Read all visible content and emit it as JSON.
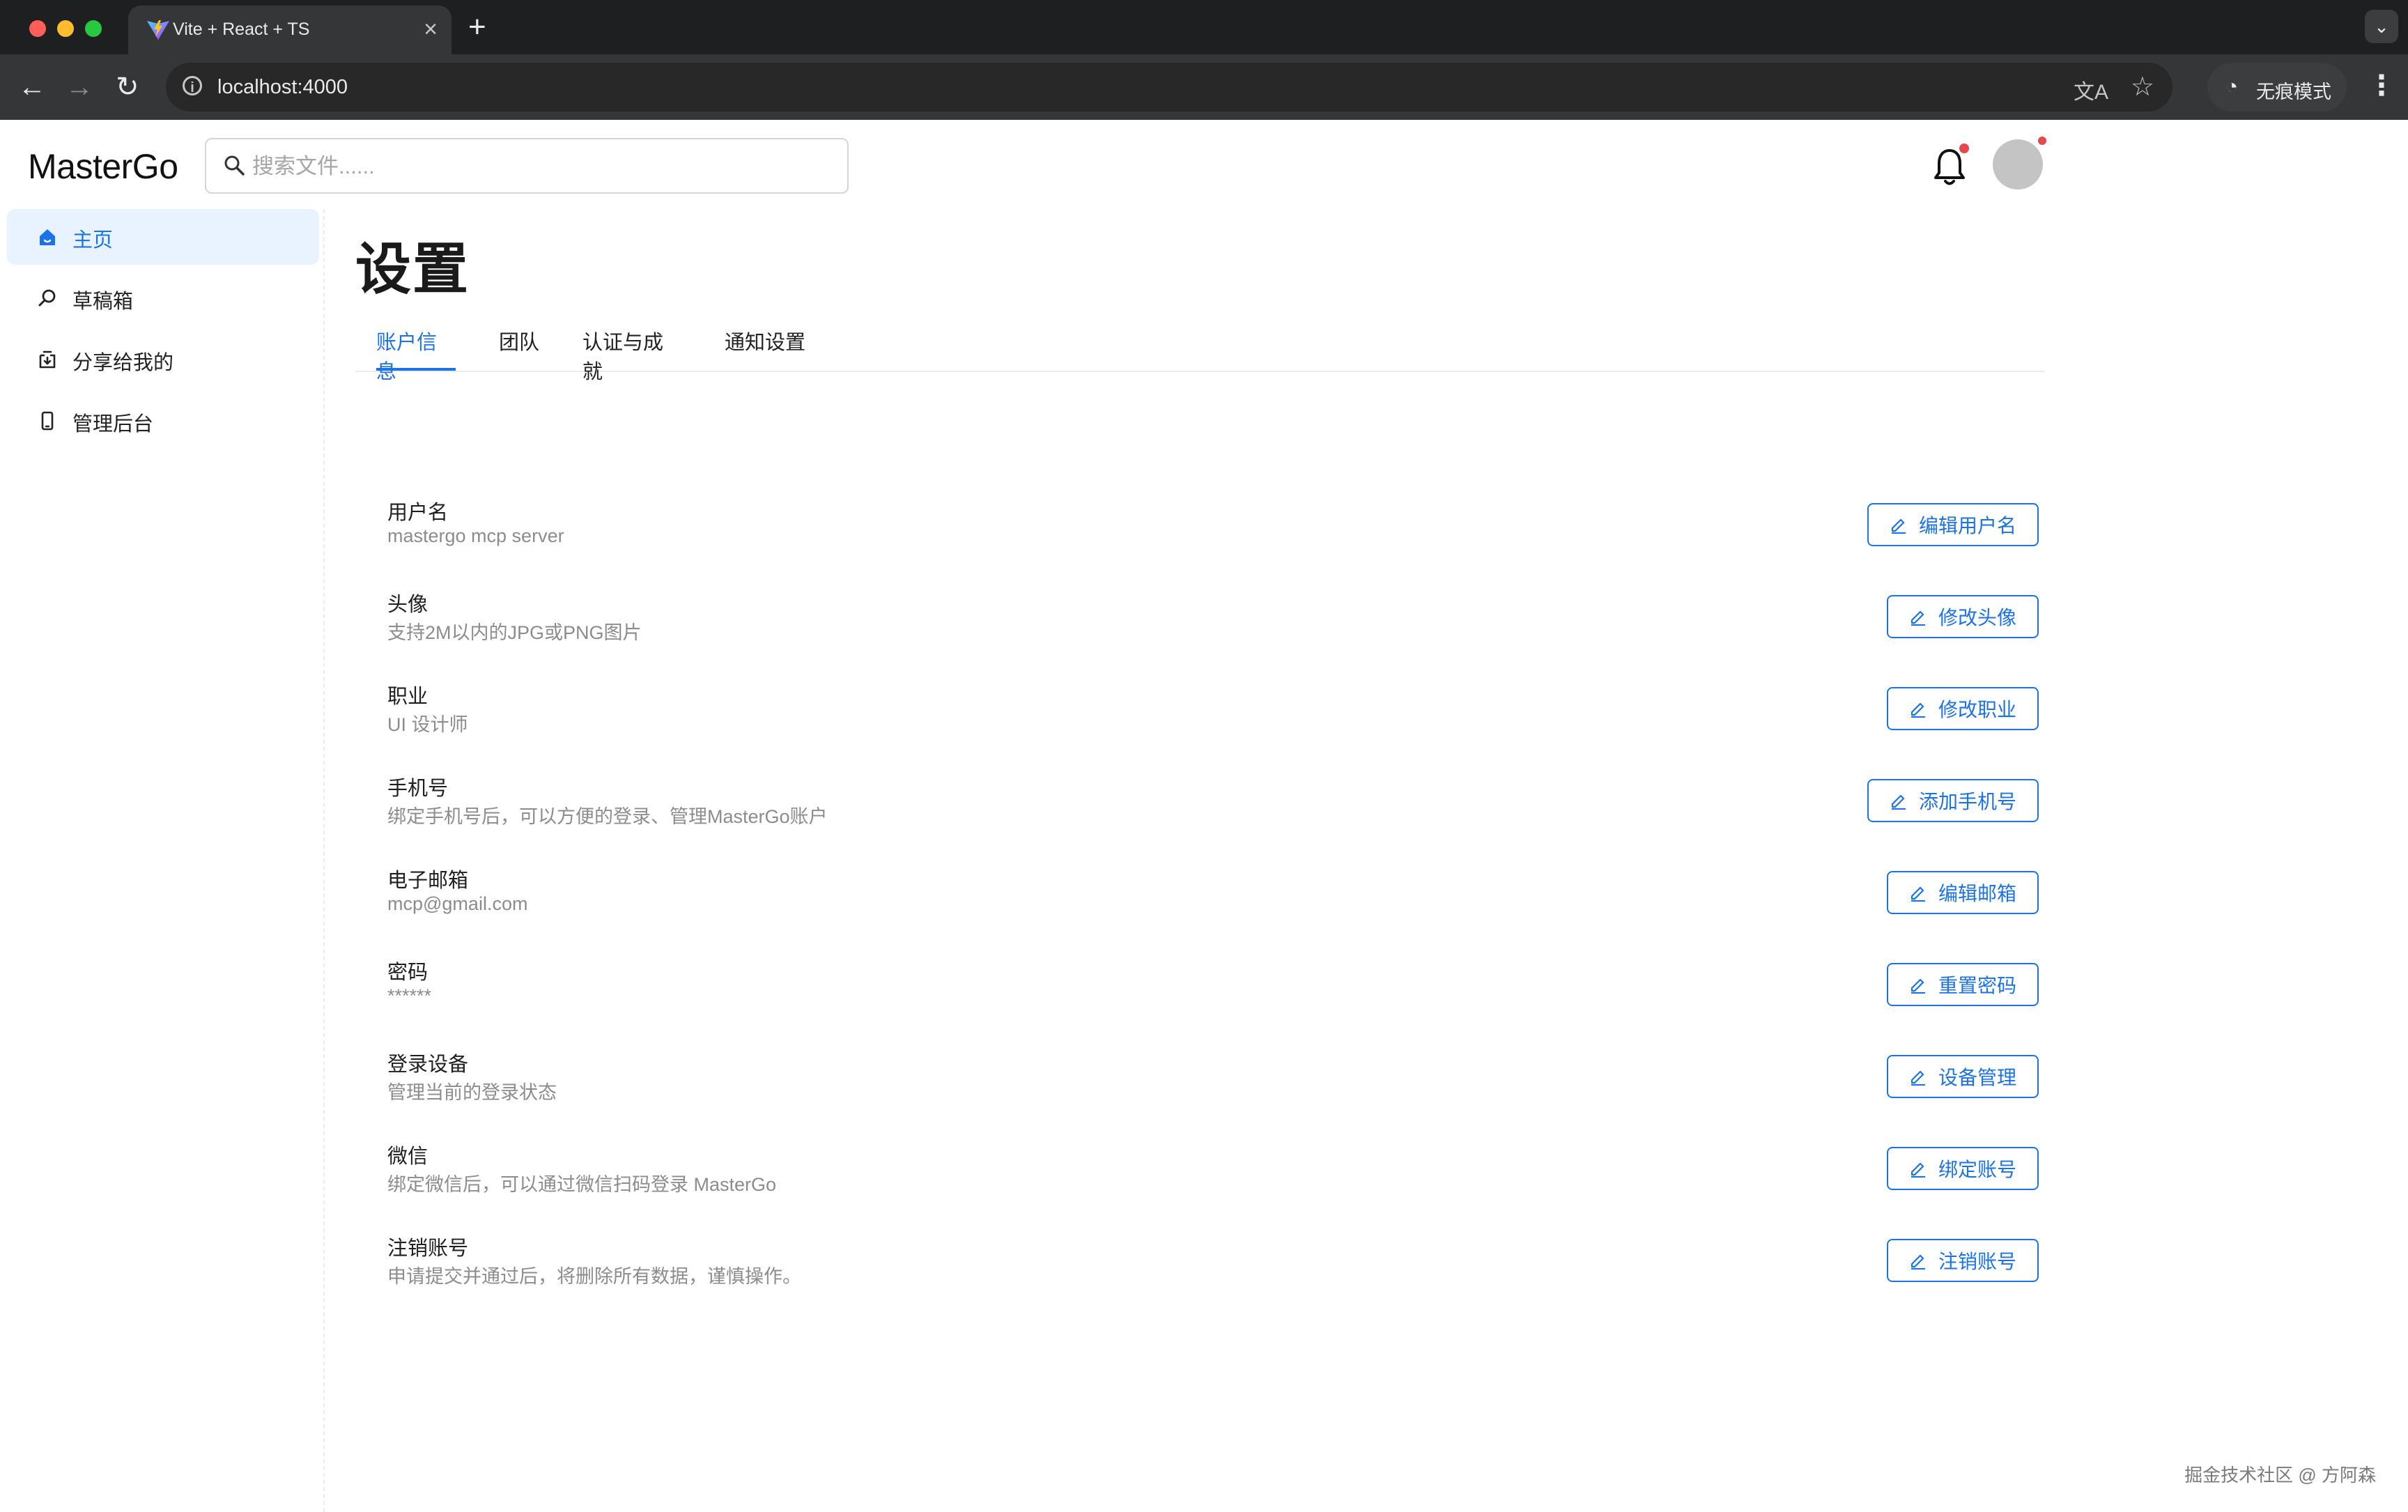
{
  "browser": {
    "tab_title": "Vite + React + TS",
    "url": "localhost:4000",
    "incognito_label": "无痕模式"
  },
  "app": {
    "logo": "MasterGo",
    "search_placeholder": "搜索文件......",
    "page_title": "设置",
    "accent_color": "#1a73e8",
    "notification_dot_color": "#e5484d"
  },
  "sidebar": {
    "items": [
      {
        "label": "主页",
        "icon": "home-icon",
        "active": true
      },
      {
        "label": "草稿箱",
        "icon": "search-icon",
        "active": false
      },
      {
        "label": "分享给我的",
        "icon": "share-inbox-icon",
        "active": false
      },
      {
        "label": "管理后台",
        "icon": "device-icon",
        "active": false
      }
    ]
  },
  "tabs": [
    {
      "label": "账户信息",
      "active": true
    },
    {
      "label": "团队",
      "active": false
    },
    {
      "label": "认证与成就",
      "active": false
    },
    {
      "label": "通知设置",
      "active": false
    }
  ],
  "settings": [
    {
      "label": "用户名",
      "desc": "mastergo mcp server",
      "button": "编辑用户名"
    },
    {
      "label": "头像",
      "desc": "支持2M以内的JPG或PNG图片",
      "button": "修改头像"
    },
    {
      "label": "职业",
      "desc": "UI 设计师",
      "button": "修改职业"
    },
    {
      "label": "手机号",
      "desc": "绑定手机号后，可以方便的登录、管理MasterGo账户",
      "button": "添加手机号"
    },
    {
      "label": "电子邮箱",
      "desc": "mcp@gmail.com",
      "button": "编辑邮箱"
    },
    {
      "label": "密码",
      "desc": "******",
      "button": "重置密码"
    },
    {
      "label": "登录设备",
      "desc": "管理当前的登录状态",
      "button": "设备管理"
    },
    {
      "label": "微信",
      "desc": "绑定微信后，可以通过微信扫码登录 MasterGo",
      "button": "绑定账号"
    },
    {
      "label": "注销账号",
      "desc": "申请提交并通过后，将删除所有数据，谨慎操作。",
      "button": "注销账号"
    }
  ],
  "watermark": "掘金技术社区 @ 方阿森"
}
